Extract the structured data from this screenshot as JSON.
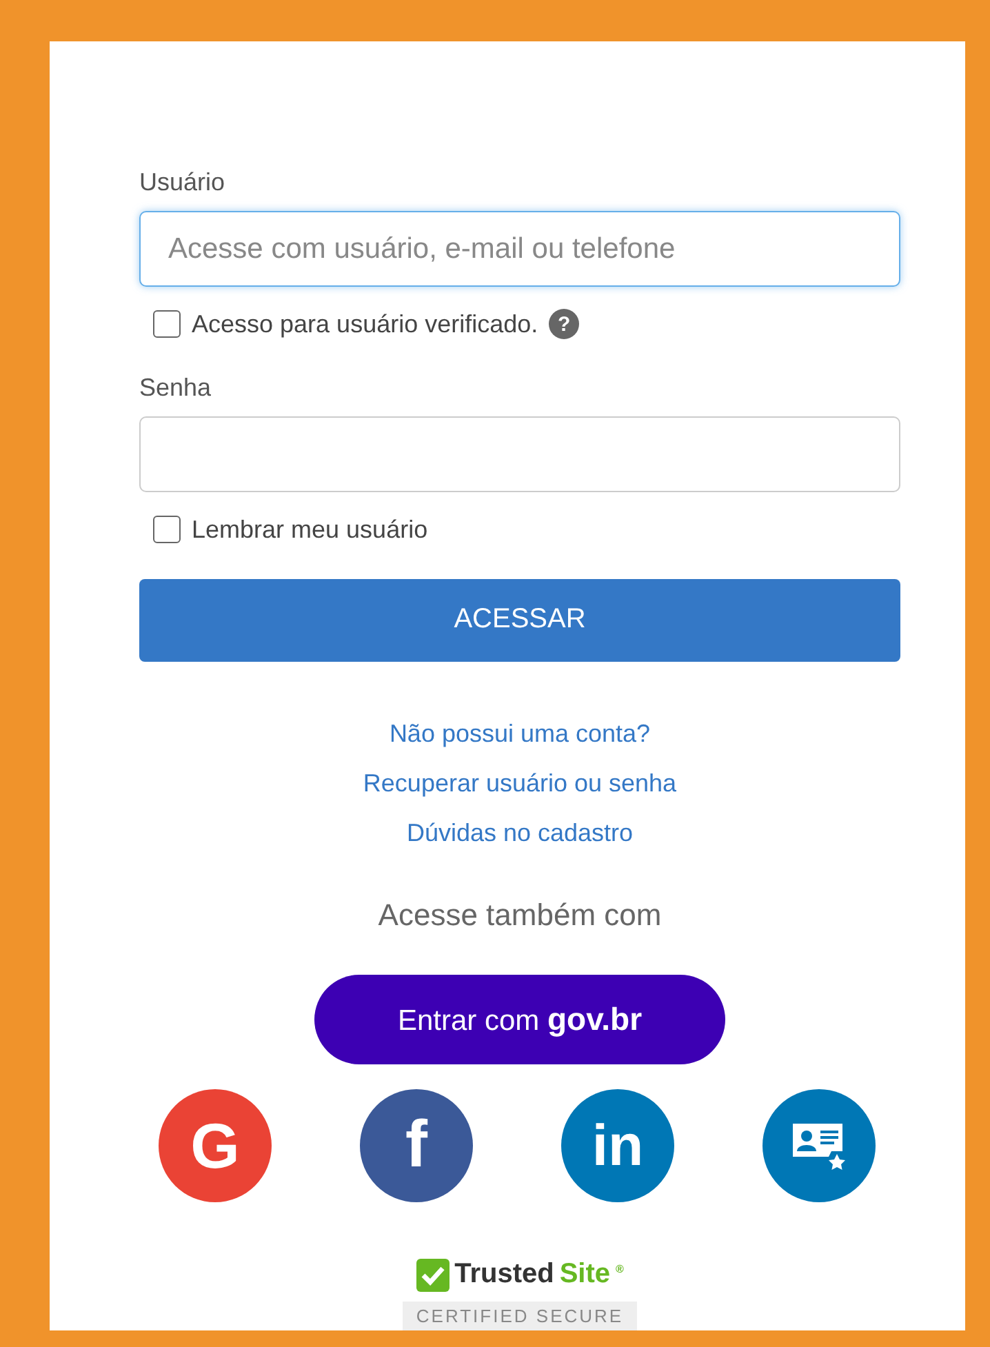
{
  "user_field": {
    "label": "Usuário",
    "placeholder": "Acesse com usuário, e-mail ou telefone",
    "focused": true
  },
  "verified_option": {
    "label": "Acesso para usuário verificado.",
    "checked": false,
    "help": "?"
  },
  "password_field": {
    "label": "Senha"
  },
  "remember_option": {
    "label": "Lembrar meu usuário",
    "checked": false
  },
  "submit_button": "ACESSAR",
  "links": [
    "Não possui uma conta?",
    "Recuperar usuário ou senha",
    "Dúvidas no cadastro"
  ],
  "alt_login": {
    "heading": "Acesse também com",
    "govbr_button": "Entrar com **gov.br**",
    "social": [
      {
        "kind": "google",
        "text": "G",
        "color": "#ea4335"
      },
      {
        "kind": "facebook",
        "text": "f",
        "color": "#3b5998"
      },
      {
        "kind": "linkedin",
        "text": "in",
        "color": "#0077b5"
      },
      {
        "kind": "certificate",
        "color": "#0077b5"
      }
    ]
  },
  "seal": {
    "brand_left": "Trusted",
    "brand_right": "Site",
    "mark": "®",
    "caption": "CERTIFIED SECURE"
  }
}
